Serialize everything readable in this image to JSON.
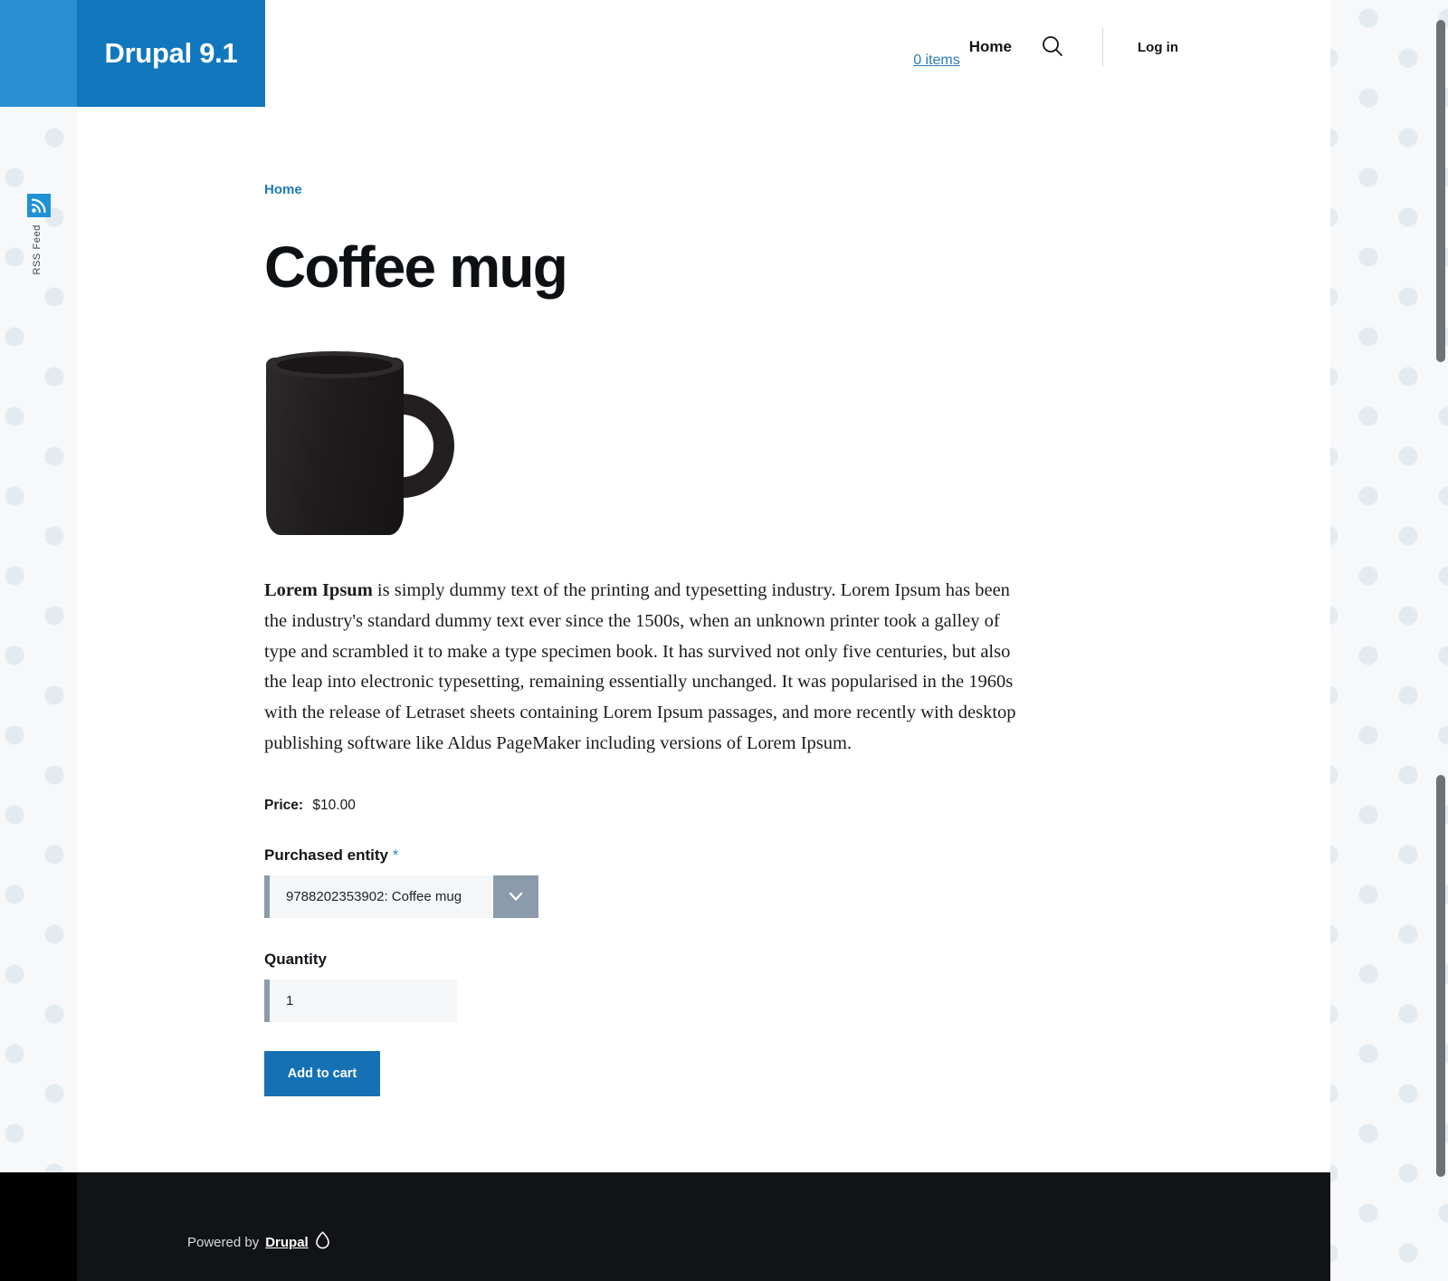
{
  "site": {
    "logo_text": "Drupal 9.1",
    "header_strip_color": "#2a90d1",
    "logo_block_color": "#1177bd"
  },
  "header": {
    "cart_label": "0 items",
    "nav_home": "Home",
    "search_icon": "search-icon",
    "login_label": "Log in"
  },
  "rss": {
    "label": "RSS Feed",
    "icon": "rss-feed-icon",
    "icon_color": "#1f92d6"
  },
  "breadcrumb": {
    "home": "Home"
  },
  "product": {
    "title": "Coffee mug",
    "image_alt": "black coffee mug",
    "description_lead": "Lorem Ipsum",
    "description_rest": " is simply dummy text of the printing and typesetting industry. Lorem Ipsum has been the industry's standard dummy text ever since the 1500s, when an unknown printer took a galley of type and scrambled it to make a type specimen book. It has survived not only five centuries, but also the leap into electronic typesetting, remaining essentially unchanged. It was popularised in the 1960s with the release of Letraset sheets containing Lorem Ipsum passages, and more recently with desktop publishing software like Aldus PageMaker including versions of Lorem Ipsum.",
    "price_label": "Price:",
    "price_value": "$10.00"
  },
  "form": {
    "purchased_entity_label": "Purchased entity",
    "required_mark": "*",
    "purchased_entity_value": "9788202353902: Coffee mug",
    "purchased_entity_options": [
      "9788202353902: Coffee mug"
    ],
    "quantity_label": "Quantity",
    "quantity_value": "1",
    "submit_label": "Add to cart",
    "submit_color": "#1571b4"
  },
  "footer": {
    "powered_by": "Powered by",
    "drupal_link": "Drupal",
    "drop_icon": "drupal-drop-icon"
  }
}
